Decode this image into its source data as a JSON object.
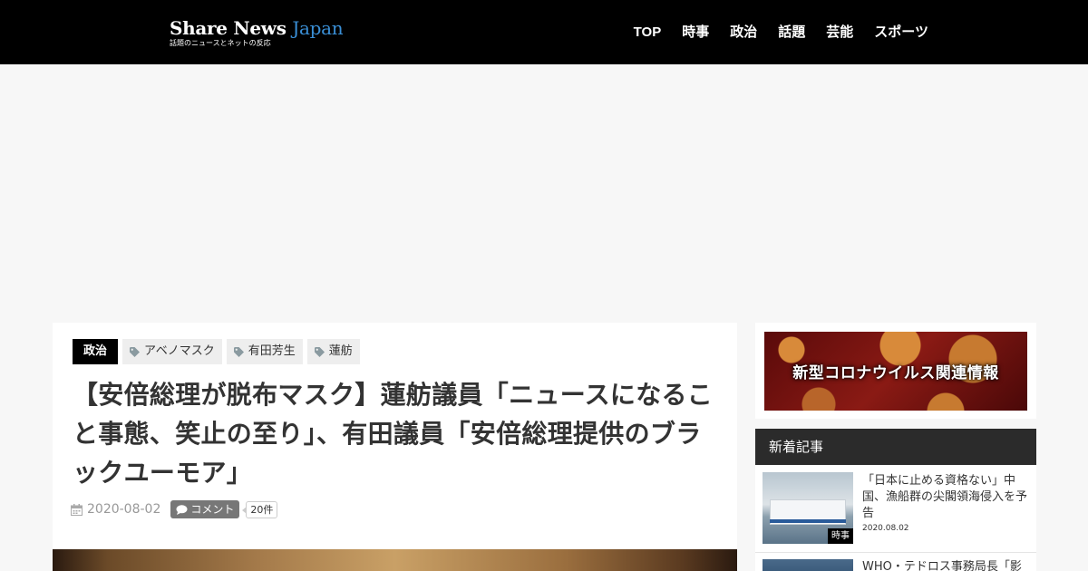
{
  "header": {
    "logo_main": "Share News",
    "logo_accent": "Japan",
    "logo_sub": "話題のニュースとネットの反応",
    "nav": [
      "TOP",
      "時事",
      "政治",
      "話題",
      "芸能",
      "スポーツ"
    ]
  },
  "article": {
    "category": "政治",
    "tags": [
      "アベノマスク",
      "有田芳生",
      "蓮舫"
    ],
    "title": "【安倍総理が脱布マスク】蓮舫議員「ニュースになること事態、笑止の至り」、有田議員「安倍総理提供のブラックユーモア」",
    "date": "2020-08-02",
    "comment_label": "コメント",
    "comment_count": "20件"
  },
  "sidebar": {
    "banner_text": "新型コロナウイルス関連情報",
    "new_posts_heading": "新着記事",
    "posts": [
      {
        "title": "「日本に止める資格ない」中国、漁船群の尖閣領海侵入を予告",
        "date": "2020.08.02",
        "category": "時事"
      },
      {
        "title": "WHO・テドロス事務局長「影"
      }
    ]
  },
  "colors": {
    "header_bg": "#000000",
    "logo_accent": "#3a8fd6",
    "category_badge": "#000000",
    "sidebar_heading_bg": "#2b2b2b"
  }
}
